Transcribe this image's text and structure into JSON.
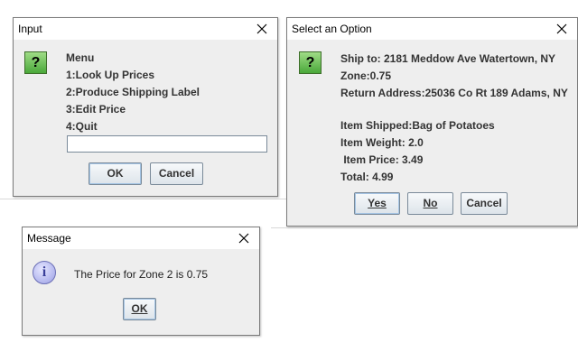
{
  "input_dialog": {
    "title": "Input",
    "menu_lines": [
      "Menu",
      "1:Look Up Prices",
      "2:Produce Shipping Label",
      "3:Edit Price",
      "4:Quit"
    ],
    "input_value": "",
    "ok_label": "OK",
    "cancel_label": "Cancel"
  },
  "option_dialog": {
    "title": "Select an Option",
    "lines": [
      "Ship to: 2181 Meddow Ave Watertown, NY",
      "Zone:0.75",
      "Return Address:25036 Co Rt 189 Adams, NY",
      "Item Shipped:Bag of Potatoes",
      "Item Weight: 2.0",
      " Item Price: 3.49",
      "Total: 4.99"
    ],
    "yes_label": "Yes",
    "no_label": "No",
    "cancel_label": "Cancel"
  },
  "message_dialog": {
    "title": "Message",
    "message": "The Price for Zone 2 is 0.75",
    "ok_label": "OK"
  },
  "icons": {
    "question": "?",
    "info": "i",
    "close": "close-x"
  },
  "colors": {
    "dialog_bg": "#eeeeee",
    "question_icon": "#4aa83a",
    "info_icon": "#9a9ee0"
  }
}
